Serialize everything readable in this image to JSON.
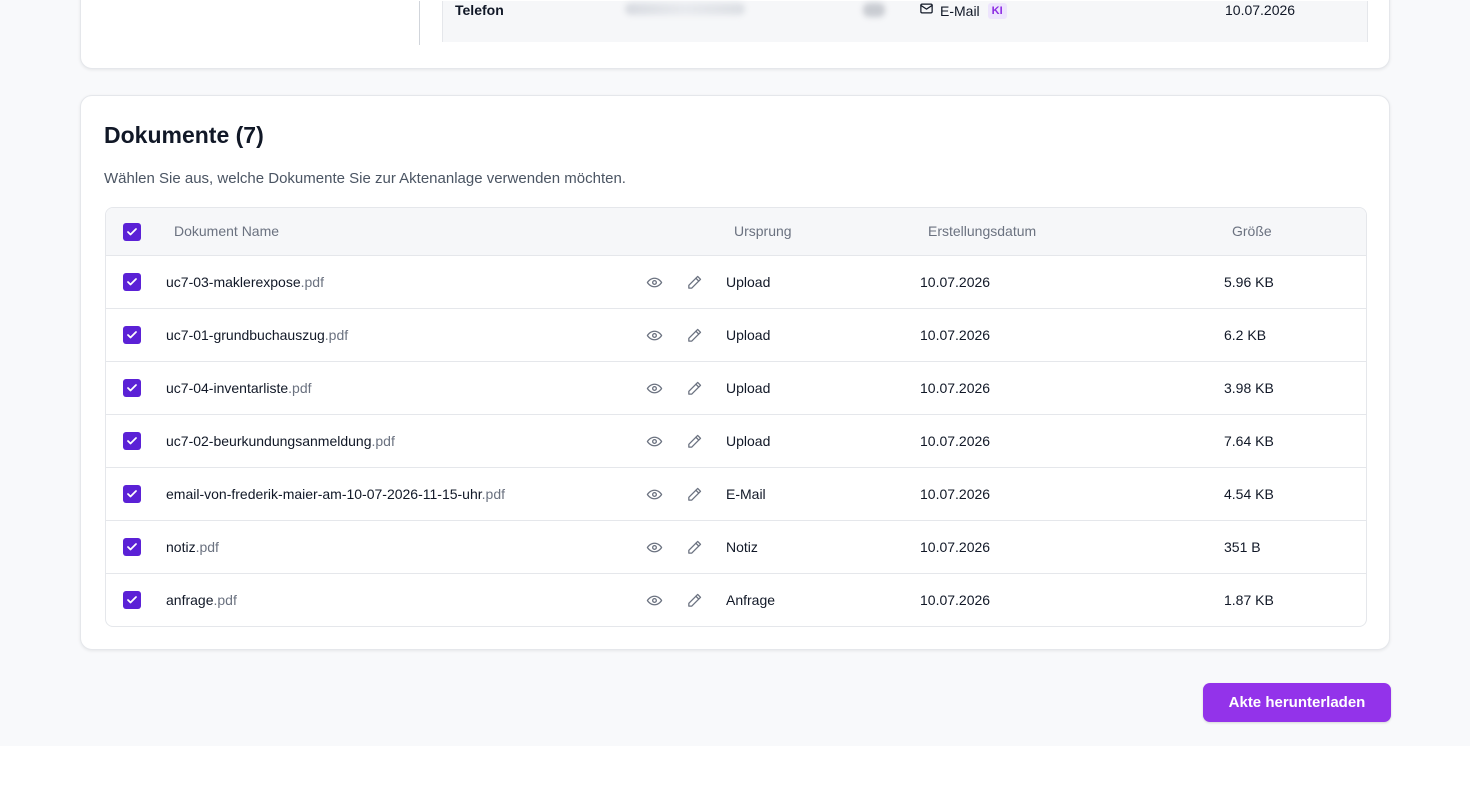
{
  "contact": {
    "label": "Telefon",
    "channel": "E-Mail",
    "badge": "KI",
    "date": "10.07.2026"
  },
  "documents": {
    "title": "Dokumente (7)",
    "subtitle": "Wählen Sie aus, welche Dokumente Sie zur Aktenanlage verwenden möchten.",
    "columns": {
      "name": "Dokument Name",
      "origin": "Ursprung",
      "created": "Erstellungsdatum",
      "size": "Größe"
    },
    "all_selected": true,
    "rows": [
      {
        "name": "uc7-03-maklerexpose",
        "ext": ".pdf",
        "origin": "Upload",
        "date": "10.07.2026",
        "size": "5.96 KB",
        "checked": true
      },
      {
        "name": "uc7-01-grundbuchauszug",
        "ext": ".pdf",
        "origin": "Upload",
        "date": "10.07.2026",
        "size": "6.2 KB",
        "checked": true
      },
      {
        "name": "uc7-04-inventarliste",
        "ext": ".pdf",
        "origin": "Upload",
        "date": "10.07.2026",
        "size": "3.98 KB",
        "checked": true
      },
      {
        "name": "uc7-02-beurkundungsanmeldung",
        "ext": ".pdf",
        "origin": "Upload",
        "date": "10.07.2026",
        "size": "7.64 KB",
        "checked": true
      },
      {
        "name": "email-von-frederik-maier-am-10-07-2026-11-15-uhr",
        "ext": ".pdf",
        "origin": "E-Mail",
        "date": "10.07.2026",
        "size": "4.54 KB",
        "checked": true
      },
      {
        "name": "notiz",
        "ext": ".pdf",
        "origin": "Notiz",
        "date": "10.07.2026",
        "size": "351 B",
        "checked": true
      },
      {
        "name": "anfrage",
        "ext": ".pdf",
        "origin": "Anfrage",
        "date": "10.07.2026",
        "size": "1.87 KB",
        "checked": true
      }
    ]
  },
  "actions": {
    "download_label": "Akte herunterladen"
  },
  "colors": {
    "checkbox": "#5b21d6",
    "primary_button": "#9333ea",
    "ki_badge_bg": "#ede4fd",
    "ki_badge_text": "#8b2be2"
  },
  "icons": {
    "preview": "eye-icon",
    "edit": "pencil-icon",
    "channel": "mail-icon",
    "check": "check-icon"
  }
}
